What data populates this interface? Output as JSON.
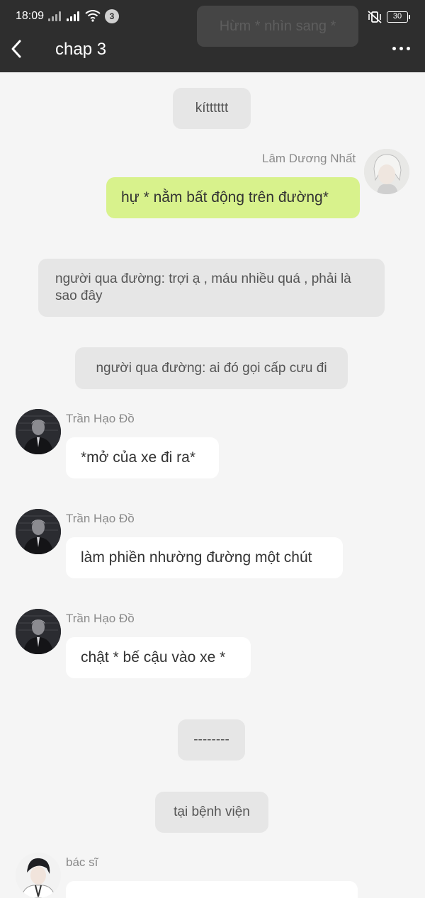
{
  "status_bar": {
    "time": "18:09",
    "notification_count": "3",
    "battery": "30"
  },
  "ghost_text": "Hừm * nhìn sang *",
  "header": {
    "title": "chap 3"
  },
  "messages": {
    "m1": {
      "text": "kítttttt"
    },
    "m2": {
      "name": "Lâm Dương Nhất",
      "text": "hự * nằm bất động trên đường*"
    },
    "m3": {
      "text": "người qua đường: trợi ạ , máu nhiều quá , phải là sao đây"
    },
    "m4": {
      "text": "người qua đường: ai đó gọi cấp cưu đi"
    },
    "m5": {
      "name": "Trần Hạo Đồ",
      "text": "*mở của xe đi ra*"
    },
    "m6": {
      "name": "Trần Hạo Đồ",
      "text": "làm phiền nhường đường một chút"
    },
    "m7": {
      "name": "Trần Hạo Đồ",
      "text": "chật * bế cậu vào xe *"
    },
    "m8": {
      "text": "--------"
    },
    "m9": {
      "text": "tại bệnh viện"
    },
    "m10": {
      "name": "bác sĩ",
      "text": ""
    }
  },
  "colors": {
    "topbar": "#2e2e2e",
    "background": "#f5f5f5",
    "my_bubble": "#d8f28c",
    "other_bubble": "#ffffff",
    "narration_bubble": "#e6e6e6"
  }
}
